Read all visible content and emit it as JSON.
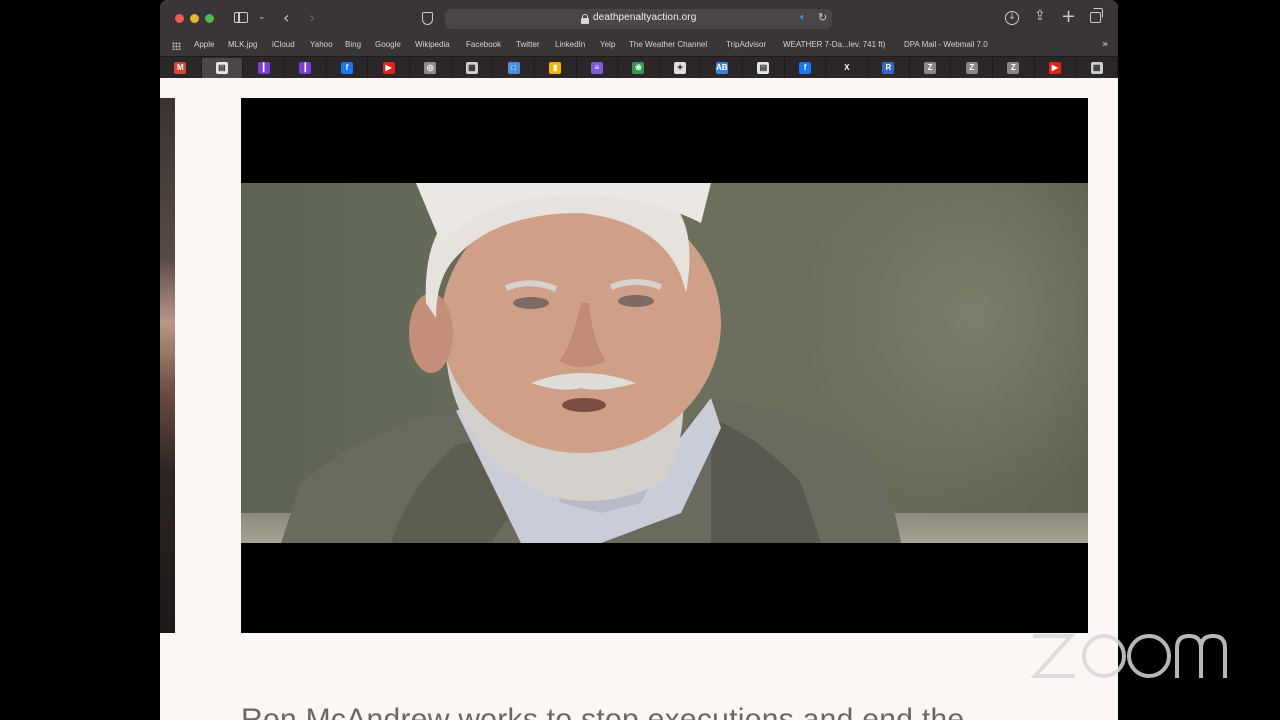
{
  "browser": {
    "url": "deathpenaltyaction.org",
    "favorites": [
      "Apple",
      "MLK.jpg",
      "iCloud",
      "Yahoo",
      "Bing",
      "Google",
      "Wikipedia",
      "Facebook",
      "Twitter",
      "LinkedIn",
      "Yelp",
      "The Weather Channel",
      "TripAdvisor",
      "WEATHER 7-Da...lev. 741 ft)",
      "DPA Mail - Webmail 7.0"
    ],
    "tabs": [
      {
        "icon": "gmail-icon",
        "glyph": "M",
        "color": "#d44638"
      },
      {
        "icon": "page-icon",
        "glyph": "▤",
        "color": "#e8e4e4",
        "active": true
      },
      {
        "icon": "stripes-icon",
        "glyph": "┃",
        "color": "#7a3fd1"
      },
      {
        "icon": "stripes-icon",
        "glyph": "┃",
        "color": "#7a3fd1"
      },
      {
        "icon": "facebook-icon",
        "glyph": "f",
        "color": "#1877f2"
      },
      {
        "icon": "youtube-icon",
        "glyph": "▶",
        "color": "#e62117"
      },
      {
        "icon": "globe-icon",
        "glyph": "◎",
        "color": "#8c8c8c"
      },
      {
        "icon": "calendar-icon",
        "glyph": "▦",
        "color": "#d0cccc"
      },
      {
        "icon": "doc-icon",
        "glyph": "□",
        "color": "#4a90d9"
      },
      {
        "icon": "bookmark-icon",
        "glyph": "▮",
        "color": "#f4b400"
      },
      {
        "icon": "list-icon",
        "glyph": "≡",
        "color": "#7b5cd6"
      },
      {
        "icon": "leaf-icon",
        "glyph": "❀",
        "color": "#2e9b4f"
      },
      {
        "icon": "bird-icon",
        "glyph": "✦",
        "color": "#dcdcdc"
      },
      {
        "icon": "ab-icon",
        "glyph": "AB",
        "color": "#3b82d6"
      },
      {
        "icon": "page-icon",
        "glyph": "▤",
        "color": "#e8e4e4"
      },
      {
        "icon": "facebook-icon",
        "glyph": "f",
        "color": "#1877f2"
      },
      {
        "icon": "x-icon",
        "glyph": "X",
        "color": "#2b2728"
      },
      {
        "icon": "r-icon",
        "glyph": "R",
        "color": "#3866c9"
      },
      {
        "icon": "z-icon",
        "glyph": "Z",
        "color": "#8a8585"
      },
      {
        "icon": "z-icon",
        "glyph": "Z",
        "color": "#8a8585"
      },
      {
        "icon": "z-icon",
        "glyph": "Z",
        "color": "#8a8585"
      },
      {
        "icon": "youtube-icon",
        "glyph": "▶",
        "color": "#e62117"
      },
      {
        "icon": "calendar-icon",
        "glyph": "▦",
        "color": "#d0cccc"
      }
    ]
  },
  "page": {
    "caption": "Ron McAndrew works to stop executions and end the"
  },
  "overlay": {
    "watermark": "zoom"
  },
  "colors": {
    "toolbar": "#3a3536",
    "page_background": "#fcf7f5",
    "accent_audio": "#3f8ef0"
  }
}
